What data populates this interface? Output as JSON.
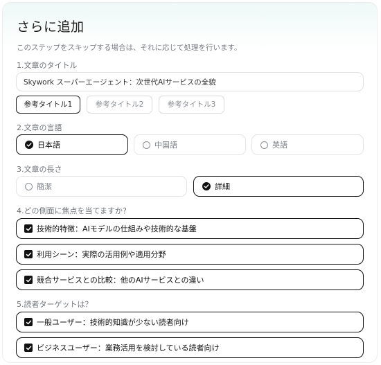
{
  "panel": {
    "title": "さらに追加",
    "description": "このステップをスキップする場合は、それに応じて処理を行います。"
  },
  "sections": {
    "title": {
      "label": "1.文章のタイトル",
      "input_value": "Skywork スーパーエージェント：次世代AIサービスの全貌",
      "chips": [
        "参考タイトル1",
        "参考タイトル2",
        "参考タイトル3"
      ],
      "selected_chip": 0
    },
    "language": {
      "label": "2.文章の言語",
      "options": [
        "日本語",
        "中国語",
        "英語"
      ],
      "selected": 0
    },
    "length": {
      "label": "3.文章の長さ",
      "options": [
        "簡潔",
        "詳細"
      ],
      "selected": 1
    },
    "focus": {
      "label": "4.どの側面に焦点を当てますか？",
      "items": [
        "技術的特徴：AIモデルの仕組みや技術的な基盤",
        "利用シーン：実際の活用例や適用分野",
        "競合サービスとの比較：他のAIサービスとの違い"
      ],
      "checked": [
        true,
        true,
        true
      ]
    },
    "audience": {
      "label": "5.読者ターゲットは？",
      "items": [
        "一般ユーザー：技術的知識が少ない読者向け",
        "ビジネスユーザー：業務活用を検討している読者向け"
      ],
      "checked": [
        true,
        true
      ]
    }
  },
  "icons": {
    "radio_checked": "radio-checked-icon",
    "radio_unchecked": "radio-unchecked-icon",
    "checkbox_checked": "checkbox-checked-icon"
  }
}
